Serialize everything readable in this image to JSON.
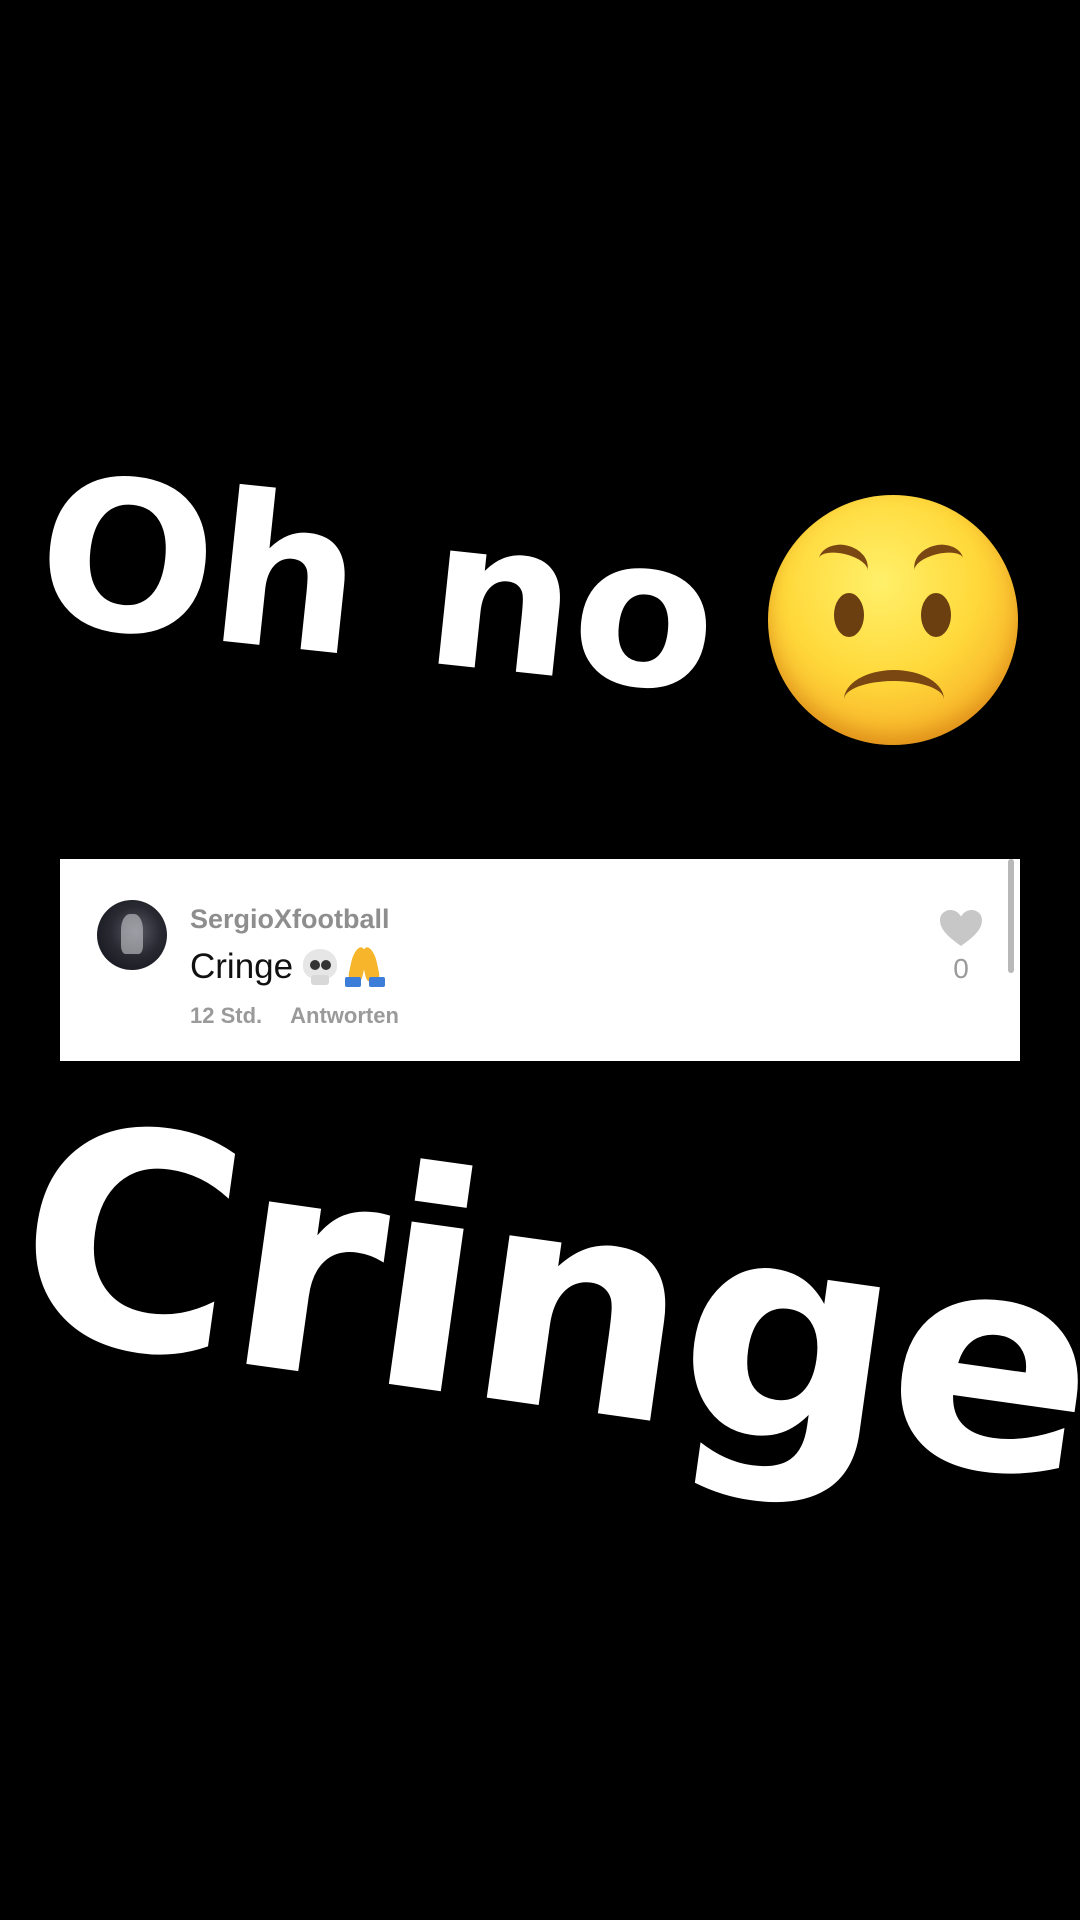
{
  "story": {
    "caption_top": "Oh no",
    "caption_top_emoji": "worried-face",
    "caption_bottom": "Cringe"
  },
  "comment": {
    "username": "SergioXfootball",
    "text": "Cringe",
    "text_emojis": [
      "skull",
      "folded-hands"
    ],
    "time": "12 Std.",
    "reply_label": "Antworten",
    "like_icon": "heart-icon",
    "like_count": "0"
  },
  "colors": {
    "background": "#000000",
    "caption": "#ffffff",
    "card": "#ffffff",
    "muted_text": "#8e8e8e",
    "heart": "#c7c7c7"
  }
}
